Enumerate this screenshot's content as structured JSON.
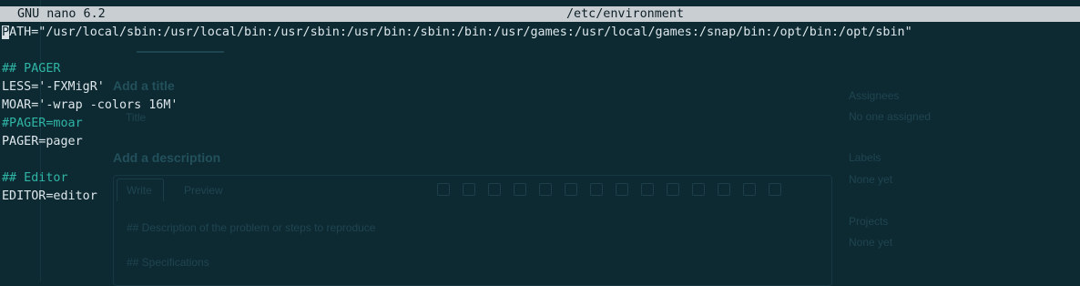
{
  "nano": {
    "version_label": "GNU nano 6.2",
    "filename": "/etc/environment"
  },
  "lines": [
    {
      "text": "PATH=\"/usr/local/sbin:/usr/local/bin:/usr/sbin:/usr/bin:/sbin:/bin:/usr/games:/usr/local/games:/snap/bin:/opt/bin:/opt/sbin\"",
      "type": "plain"
    },
    {
      "text": "",
      "type": "blank"
    },
    {
      "text": "## PAGER",
      "type": "comment"
    },
    {
      "text": "LESS='-FXMigR'",
      "type": "plain"
    },
    {
      "text": "MOAR='-wrap -colors 16M'",
      "type": "plain"
    },
    {
      "text": "#PAGER=moar",
      "type": "comment"
    },
    {
      "text": "PAGER=pager",
      "type": "plain"
    },
    {
      "text": "",
      "type": "blank"
    },
    {
      "text": "## Editor",
      "type": "comment"
    },
    {
      "text": "EDITOR=editor",
      "type": "plain"
    }
  ],
  "background_page": {
    "title_heading": "Add a title",
    "title_placeholder": "Title",
    "description_heading": "Add a description",
    "write_tab": "Write",
    "preview_tab": "Preview",
    "body_line_1": "## Description of the problem or steps to reproduce",
    "body_line_2": "## Specifications",
    "assignees_heading": "Assignees",
    "assignees_value": "No one assigned",
    "labels_heading": "Labels",
    "labels_value": "None yet",
    "projects_heading": "Projects",
    "projects_value": "None yet"
  },
  "colors": {
    "terminal_bg": "#0d2a33",
    "titlebar_bg": "#c9ced3",
    "comment": "#2fb5a6",
    "text": "#dde6ea"
  }
}
